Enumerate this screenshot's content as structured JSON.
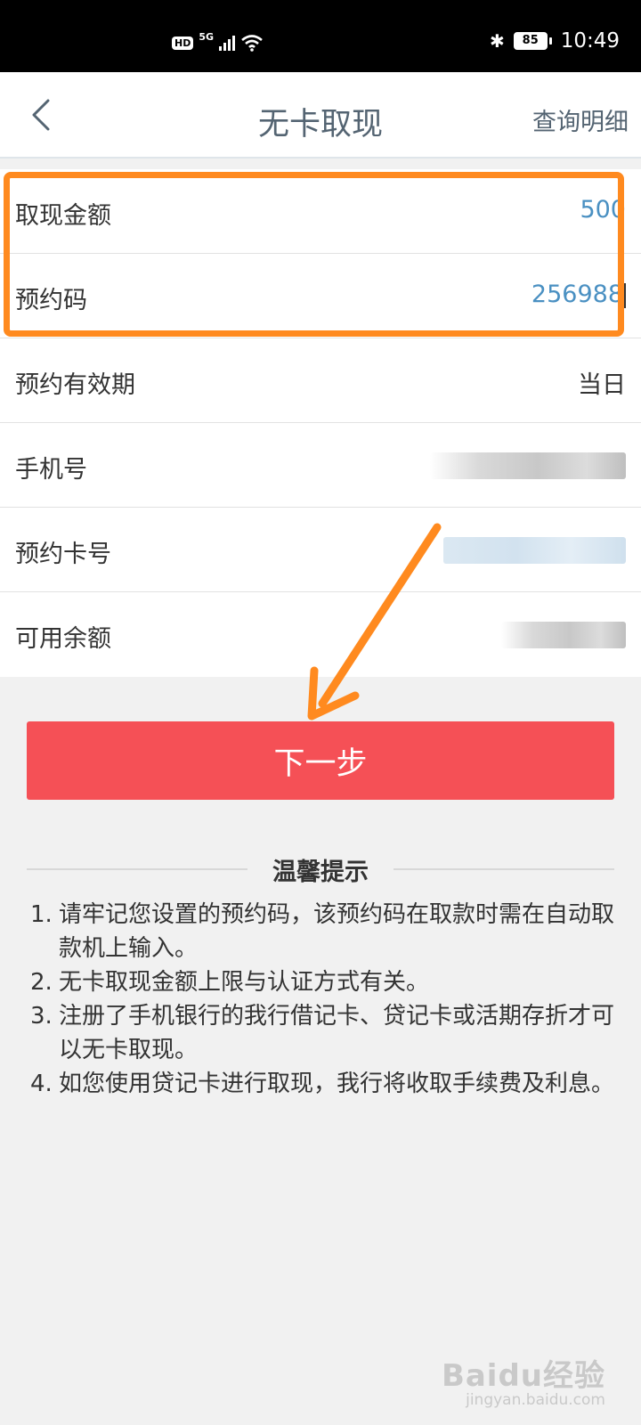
{
  "status_bar": {
    "hd_label": "HD",
    "network_label": "5G",
    "battery_level": "85",
    "time": "10:49"
  },
  "header": {
    "title": "无卡取现",
    "action_label": "查询明细"
  },
  "form": {
    "rows": [
      {
        "label": "取现金额",
        "value": "500"
      },
      {
        "label": "预约码",
        "value": "256988"
      },
      {
        "label": "预约有效期",
        "value": "当日"
      },
      {
        "label": "手机号"
      },
      {
        "label": "预约卡号"
      },
      {
        "label": "可用余额"
      }
    ]
  },
  "next_button_label": "下一步",
  "tips": {
    "title": "温馨提示",
    "items": [
      {
        "num": "1.",
        "text": "请牢记您设置的预约码，该预约码在取款时需在自动取款机上输入。"
      },
      {
        "num": "2.",
        "text": "无卡取现金额上限与认证方式有关。"
      },
      {
        "num": "3.",
        "text": "注册了手机银行的我行借记卡、贷记卡或活期存折才可以无卡取现。"
      },
      {
        "num": "4.",
        "text": "如您使用贷记卡进行取现，我行将收取手续费及利息。"
      }
    ]
  },
  "watermark": {
    "logo": "Baidu经验",
    "sub": "jingyan.baidu.com"
  },
  "colors": {
    "annotation": "#ff8a1f",
    "primary_button": "#f55056",
    "value_blue": "#4a90c2",
    "header_text": "#546472"
  }
}
